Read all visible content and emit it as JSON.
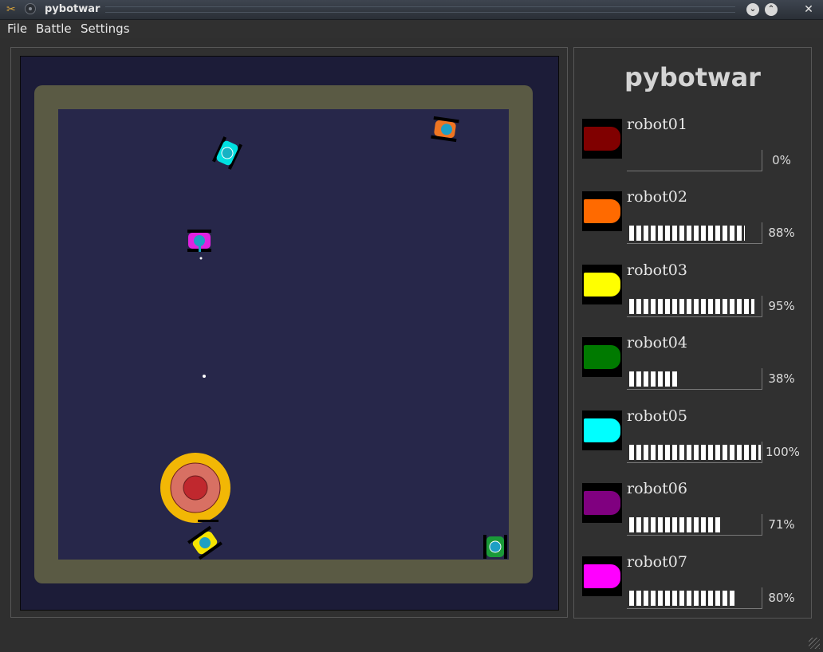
{
  "window": {
    "title": "pybotwar"
  },
  "menubar": {
    "items": [
      "File",
      "Battle",
      "Settings"
    ]
  },
  "panel": {
    "heading": "pybotwar"
  },
  "robots": [
    {
      "name": "robot01",
      "percent": "0%",
      "health": 0,
      "color": "#800000"
    },
    {
      "name": "robot02",
      "percent": "88%",
      "health": 0.88,
      "color": "#ff6a00"
    },
    {
      "name": "robot03",
      "percent": "95%",
      "health": 0.95,
      "color": "#ffff00"
    },
    {
      "name": "robot04",
      "percent": "38%",
      "health": 0.38,
      "color": "#007a00"
    },
    {
      "name": "robot05",
      "percent": "100%",
      "health": 1.0,
      "color": "#00ffff"
    },
    {
      "name": "robot06",
      "percent": "71%",
      "health": 0.71,
      "color": "#800080"
    },
    {
      "name": "robot07",
      "percent": "80%",
      "health": 0.8,
      "color": "#ff00ff"
    }
  ]
}
